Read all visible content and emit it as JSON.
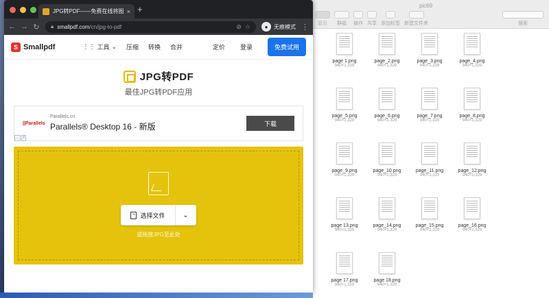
{
  "browser": {
    "tab_title": "JPG转PDF——免费在线将图片转",
    "tab_close": "×",
    "new_tab": "+",
    "url_host": "smallpdf.com",
    "url_path": "/cn/jpg-to-pdf",
    "incognito_label": "无痕模式",
    "traffic_colors": [
      "#ed6a5e",
      "#f5bf4f",
      "#62c554"
    ]
  },
  "site": {
    "logo_text": "Smallpdf",
    "logo_mark": "S",
    "menu": {
      "tools": "工具",
      "compress": "压缩",
      "convert": "转换",
      "merge": "合并"
    },
    "pricing": "定价",
    "login": "登录",
    "trial": "免费试用",
    "accent_color": "#1a73e8"
  },
  "hero": {
    "title": "JPG转PDF",
    "subtitle": "最佳JPG转PDF应用"
  },
  "ad": {
    "logo": "||Parallels",
    "domain": "Parallels.cn",
    "headline": "Parallels® Desktop 16 - 新版",
    "button": "下载",
    "tag_info": "ⓘ",
    "tag_close": "X"
  },
  "dropzone": {
    "choose_label": "选择文件",
    "hint": "或拖放JPG至此处",
    "color": "#e4c30c"
  },
  "finder": {
    "title": "pic69",
    "tools": [
      "显示",
      "群组",
      "操作",
      "共享",
      "添加标签",
      "新建文件夹",
      "搜索"
    ],
    "files": [
      {
        "name": "page 1.png",
        "size": "940×1,329"
      },
      {
        "name": "page_2.png",
        "size": "940×1,329"
      },
      {
        "name": "page_3.png",
        "size": "940×1,329"
      },
      {
        "name": "page_4.png",
        "size": "940×1,329"
      },
      {
        "name": "page_5.png",
        "size": "940×1,329"
      },
      {
        "name": "page_6.png",
        "size": "940×1,329"
      },
      {
        "name": "page_7.png",
        "size": "940×1,329"
      },
      {
        "name": "page_8.png",
        "size": "940×1,329"
      },
      {
        "name": "page_9.png",
        "size": "940×1,329"
      },
      {
        "name": "page_10.png",
        "size": "940×1,329"
      },
      {
        "name": "page_11.png",
        "size": "940×1,329"
      },
      {
        "name": "page_12.png",
        "size": "940×1,329"
      },
      {
        "name": "page 13.png",
        "size": "940×1,329"
      },
      {
        "name": "page_14.png",
        "size": "940×1,329"
      },
      {
        "name": "page_15.png",
        "size": "940×1,329"
      },
      {
        "name": "page_16.png",
        "size": "940×1,329"
      },
      {
        "name": "page 17.png",
        "size": "940×1,329"
      },
      {
        "name": "page 18.png",
        "size": "940×1,329"
      }
    ]
  }
}
